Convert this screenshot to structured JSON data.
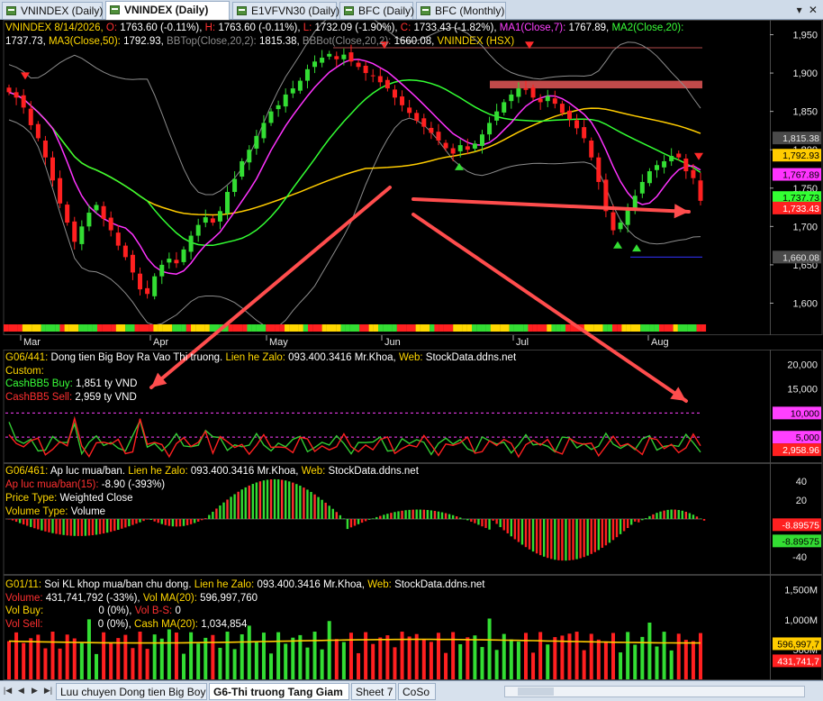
{
  "tabs": [
    {
      "label": "VNINDEX (Daily)",
      "active": false
    },
    {
      "label": "VNINDEX (Daily)",
      "active": true
    },
    {
      "label": "E1VFVN30 (Daily)",
      "active": false
    },
    {
      "label": "BFC (Daily)",
      "active": false
    },
    {
      "label": "BFC (Monthly)",
      "active": false
    }
  ],
  "window_controls": "▾ ✕",
  "price_panel": {
    "legend": {
      "symbol_date": "VNINDEX 8/14/2026,",
      "o_label": "O:",
      "o_value": "1763.60 (-0.11%),",
      "h_label": "H:",
      "h_value": "1763.60 (-0.11%),",
      "l_label": "L:",
      "l_value": "1732.09 (-1.90%),",
      "c_label": "C:",
      "c_value": "1733.43 (-1.82%),",
      "ma1": "MA1(Close,7):",
      "ma1_value": "1767.89,",
      "ma2": "MA2(Close,20):",
      "ma2_value": "1737.73,",
      "ma3": "MA3(Close,50):",
      "ma3_value": "1792.93,",
      "bbtop": "BBTop(Close,20,2):",
      "bbtop_value": "1815.38,",
      "bbbot": "BBBot(Close,20,2):",
      "bbbot_value": "1660.08,",
      "src": "VNINDEX (HSX)"
    },
    "y_ticks": [
      "1,950",
      "1,900",
      "1,850",
      "1,800",
      "1,750",
      "1,700",
      "1,650",
      "1,600"
    ],
    "value_tags": [
      "1,815.38",
      "1,792.93",
      "1,767.89",
      "1,737.73",
      "1,733.43",
      "1,660.08"
    ]
  },
  "x_labels": [
    "Mar",
    "Apr",
    "May",
    "Jun",
    "Jul",
    "Aug"
  ],
  "flow_panel": {
    "title_id": "G06/441:",
    "title": "Dong tien Big Boy Ra Vao Thi truong.",
    "contact_label": "Lien he Zalo:",
    "contact": "093.400.3416 Mr.Khoa,",
    "web_label": "Web:",
    "web": "StockData.ddns.net",
    "custom": "Custom:",
    "buy_label": "CashBB5 Buy:",
    "buy_value": "1,851 ty VND",
    "sell_label": "CashBB5 Sell:",
    "sell_value": "2,959 ty VND",
    "y_ticks": [
      "20,000",
      "15,000"
    ],
    "tags": [
      "10,000",
      "5,000",
      "2,958.96"
    ]
  },
  "pressure_panel": {
    "title_id": "G06/461:",
    "title": "Ap luc mua/ban.",
    "contact_label": "Lien he Zalo:",
    "contact": "093.400.3416 Mr.Khoa,",
    "web_label": "Web:",
    "web": "StockData.ddns.net",
    "line1_label": "Ap luc mua/ban(15):",
    "line1_value": "-8.90 (-393%)",
    "price_type_label": "Price Type:",
    "price_type": "Weighted Close",
    "volume_type_label": "Volume Type:",
    "volume_type": "Volume",
    "y_ticks": [
      "40",
      "20",
      "-20",
      "-40"
    ],
    "tags": [
      "-8.89575",
      "-8.89575"
    ]
  },
  "volume_panel": {
    "title_id": "G01/11:",
    "title": "Soi KL khop mua/ban chu dong.",
    "contact_label": "Lien he Zalo:",
    "contact": "093.400.3416 Mr.Khoa,",
    "web_label": "Web:",
    "web": "StockData.ddns.net",
    "volume_label": "Volume:",
    "volume_value": "431,741,792 (-33%),",
    "volma_label": "Vol MA(20):",
    "volma_value": "596,997,760",
    "volbuy_label": "Vol Buy:",
    "volbuy_value": "0 (0%),",
    "volbs_label": "Vol B-S:",
    "volbs_value": "0",
    "volsell_label": "Vol Sell:",
    "volsell_value": "0 (0%),",
    "cashma_label": "Cash MA(20):",
    "cashma_value": "1,034,854",
    "y_ticks": [
      "1,500M",
      "1,000M",
      "500M"
    ],
    "tags": [
      "596,997,7",
      "431,741,7"
    ]
  },
  "sheets": [
    {
      "label": "Luu chuyen Dong tien Big Boy",
      "active": false
    },
    {
      "label": "G6-Thi truong Tang Giam",
      "active": true
    },
    {
      "label": "Sheet 7",
      "active": false
    },
    {
      "label": "CoSo",
      "active": false
    }
  ],
  "colors": {
    "up": "#33dd33",
    "down": "#ff2020",
    "ma1": "#ff33ff",
    "ma2": "#33ff33",
    "ma3": "#ffcc00",
    "bb": "#8c8c8c",
    "arrow": "#ff4d4d",
    "zone": "#c24a4a"
  },
  "chart_data": [
    {
      "type": "candlestick",
      "title": "VNINDEX (Daily)",
      "x_range": [
        "Mar",
        "Aug"
      ],
      "ylim": [
        1570,
        1960
      ],
      "last_bar": {
        "date": "8/14/2026",
        "open": 1763.6,
        "high": 1763.6,
        "low": 1732.09,
        "close": 1733.43
      },
      "closes": [
        1875,
        1868,
        1855,
        1832,
        1815,
        1790,
        1760,
        1730,
        1705,
        1680,
        1700,
        1718,
        1728,
        1710,
        1695,
        1675,
        1660,
        1640,
        1618,
        1612,
        1635,
        1650,
        1658,
        1652,
        1670,
        1688,
        1702,
        1712,
        1705,
        1720,
        1745,
        1762,
        1785,
        1800,
        1818,
        1835,
        1850,
        1858,
        1872,
        1880,
        1890,
        1905,
        1915,
        1920,
        1925,
        1918,
        1924,
        1915,
        1908,
        1900,
        1896,
        1888,
        1880,
        1868,
        1858,
        1848,
        1838,
        1830,
        1822,
        1812,
        1802,
        1795,
        1806,
        1800,
        1808,
        1820,
        1835,
        1850,
        1862,
        1872,
        1880,
        1878,
        1868,
        1862,
        1870,
        1860,
        1848,
        1840,
        1828,
        1815,
        1790,
        1758,
        1720,
        1695,
        1705,
        1724,
        1740,
        1758,
        1772,
        1780,
        1785,
        1792,
        1790,
        1772,
        1763,
        1733.43
      ],
      "series": [
        {
          "name": "MA1(Close,7)",
          "last": 1767.89
        },
        {
          "name": "MA2(Close,20)",
          "last": 1737.73
        },
        {
          "name": "MA3(Close,50)",
          "last": 1792.93
        },
        {
          "name": "BBTop(Close,20,2)",
          "last": 1815.38
        },
        {
          "name": "BBBot(Close,20,2)",
          "last": 1660.08
        }
      ],
      "resistance_zone": [
        1880,
        1890
      ]
    },
    {
      "type": "line",
      "title": "Dong tien Big Boy Ra Vao Thi truong",
      "ylim": [
        0,
        22000
      ],
      "reference_levels": [
        10000,
        5000
      ],
      "series": [
        {
          "name": "CashBB5 Buy",
          "last": 1851
        },
        {
          "name": "CashBB5 Sell",
          "last": 2959
        }
      ]
    },
    {
      "type": "bar",
      "title": "Ap luc mua/ban",
      "ylim": [
        -50,
        50
      ],
      "series": [
        {
          "name": "Ap luc mua/ban(15)",
          "last": -8.9
        }
      ]
    },
    {
      "type": "bar",
      "title": "Soi KL khop mua/ban chu dong",
      "ylim": [
        0,
        1600000000
      ],
      "series": [
        {
          "name": "Volume",
          "last": 431741792
        },
        {
          "name": "Vol MA(20)",
          "last": 596997760
        }
      ]
    }
  ]
}
